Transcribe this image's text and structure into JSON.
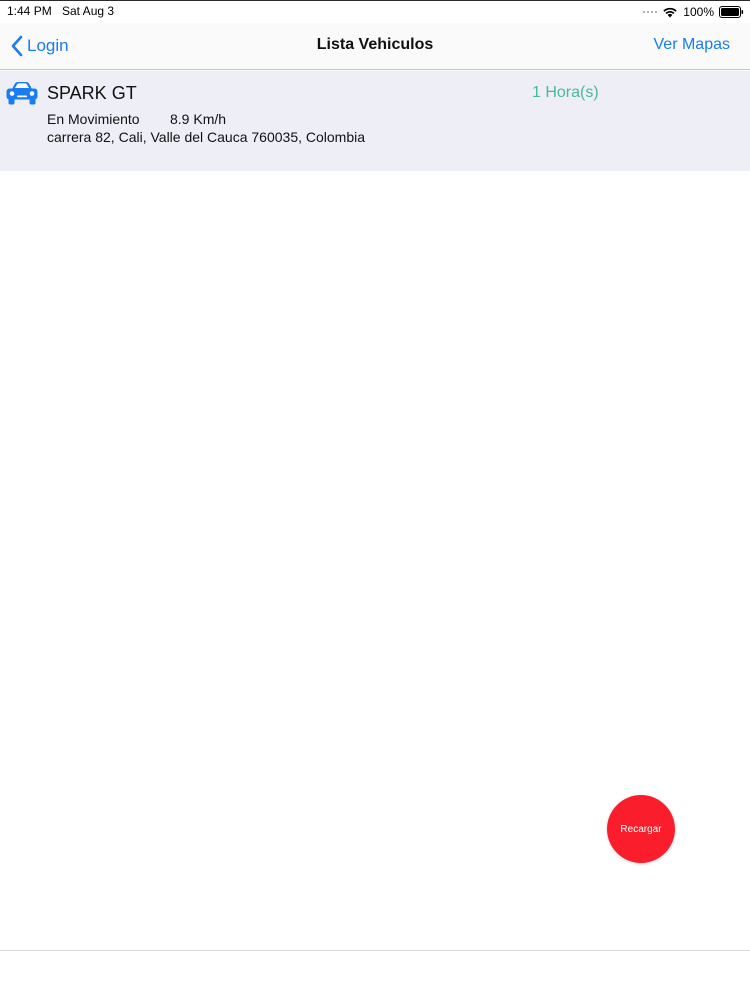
{
  "status_bar": {
    "time": "1:44 PM",
    "date": "Sat Aug 3",
    "battery": "100%",
    "wifi_icon": "wifi-icon",
    "battery_icon": "battery-icon"
  },
  "nav": {
    "back_label": "Login",
    "title": "Lista Vehiculos",
    "right_label": "Ver Mapas",
    "accent": "#1a7cf2"
  },
  "vehicles": [
    {
      "icon": "car-icon",
      "name": "SPARK GT",
      "time_ago": "1 Hora(s)",
      "status": "En Movimiento",
      "speed": "8.9 Km/h",
      "address": "carrera 82, Cali, Valle del Cauca 760035, Colombia",
      "icon_color": "#1a7cf2",
      "time_color": "#4ab89e"
    }
  ],
  "fab": {
    "label": "Recargar",
    "color": "#fa1e2d"
  }
}
